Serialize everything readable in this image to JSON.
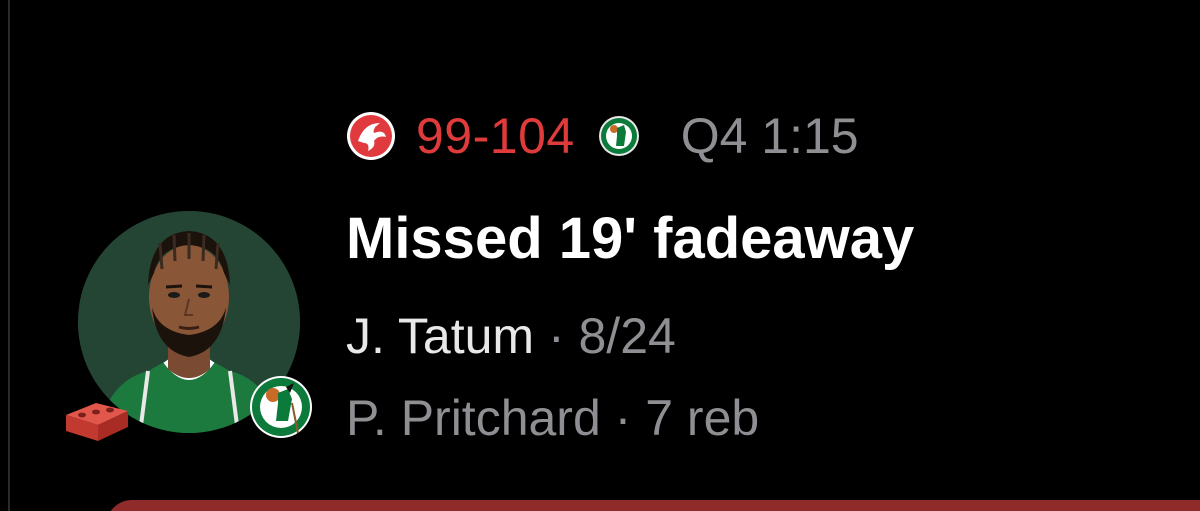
{
  "play": {
    "away_team_icon": "atlanta-hawks-logo-icon",
    "score": "99-104",
    "home_team_icon": "boston-celtics-logo-icon",
    "clock": "Q4 1:15",
    "title": "Missed 19' fadeaway",
    "player_name": "J. Tatum",
    "separator": "·",
    "player_stat": "8/24",
    "secondary_player": "P. Pritchard",
    "secondary_stat": "7 reb",
    "result_icon": "brick-icon",
    "colors": {
      "background": "#000000",
      "score": "#e03b3b",
      "secondary_text": "#8e8e93",
      "title": "#ffffff",
      "next_card": "#8f2b2b"
    }
  }
}
